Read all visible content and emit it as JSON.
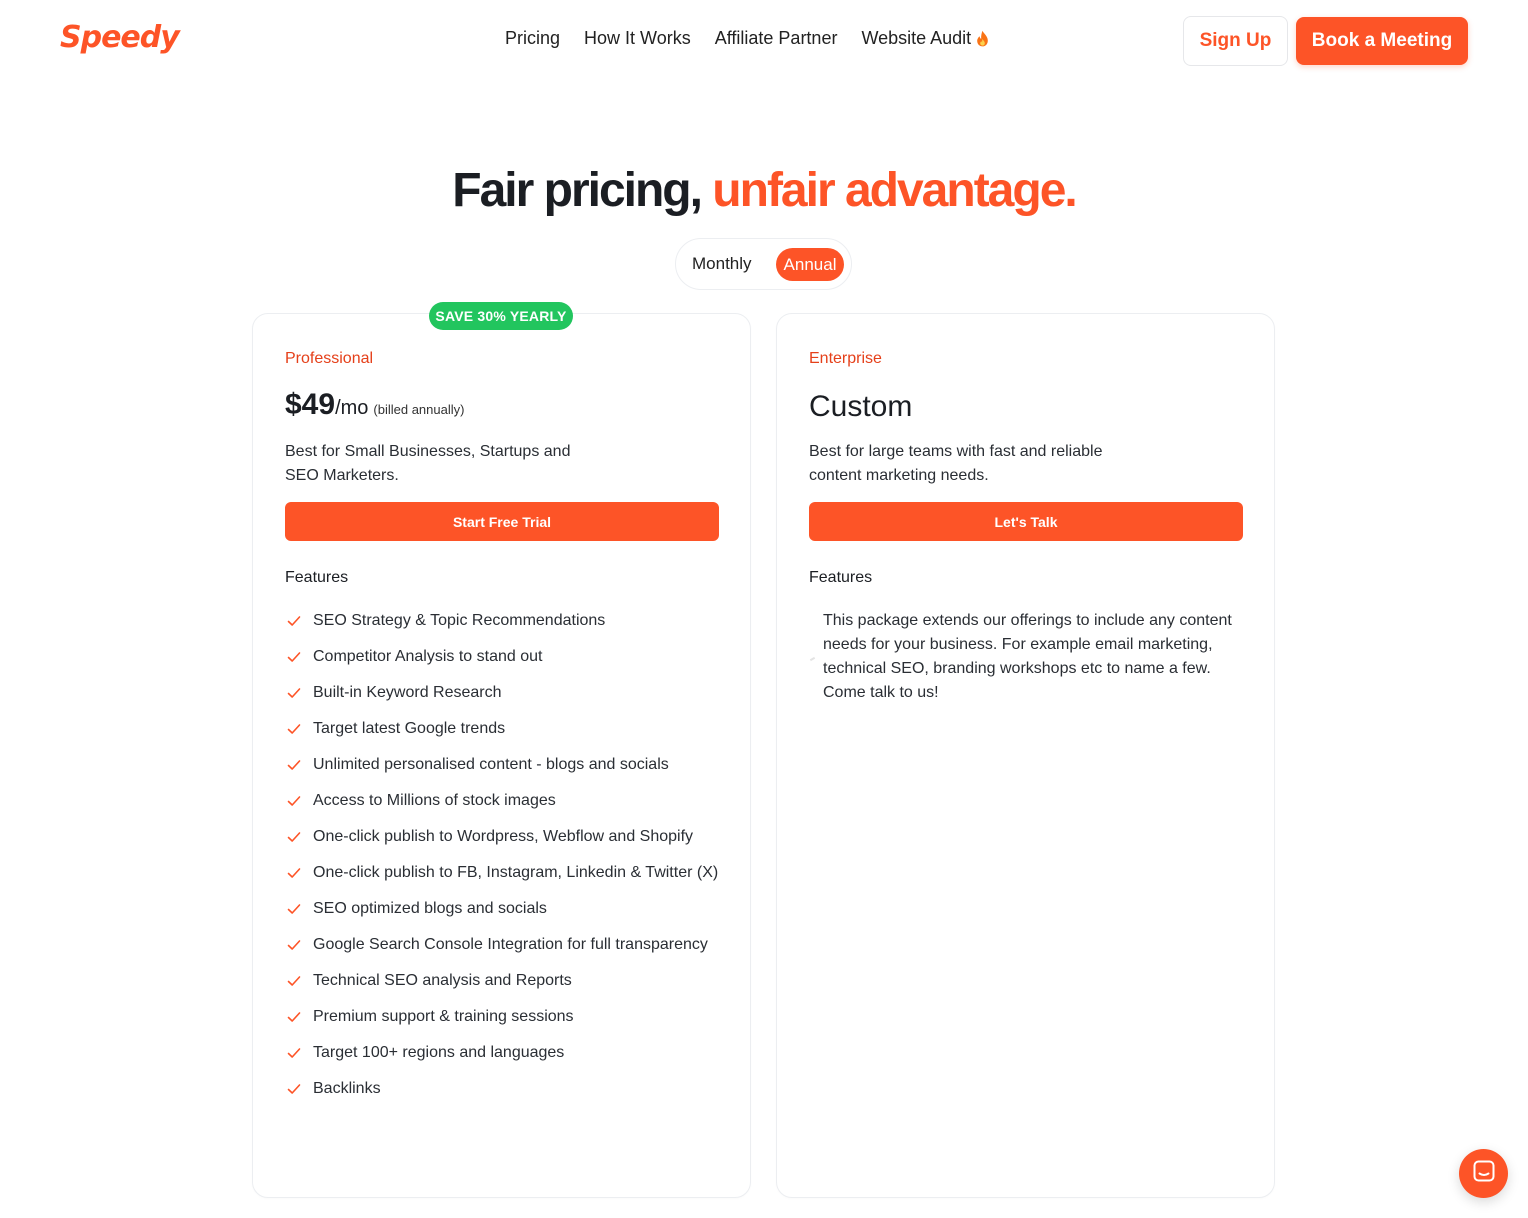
{
  "header": {
    "logo": "Speedy",
    "nav": [
      {
        "label": "Pricing"
      },
      {
        "label": "How It Works"
      },
      {
        "label": "Affiliate Partner"
      },
      {
        "label": "Website Audit",
        "icon": "flame-icon"
      }
    ],
    "signup_label": "Sign Up",
    "meeting_label": "Book a Meeting"
  },
  "hero": {
    "title_main": "Fair pricing, ",
    "title_accent": "unfair advantage."
  },
  "billing_toggle": {
    "monthly_label": "Monthly",
    "annual_label": "Annual",
    "selected": "Annual"
  },
  "plans": {
    "professional": {
      "badge": "SAVE 30% YEARLY",
      "name": "Professional",
      "price": "$49",
      "price_unit": "/mo",
      "price_note": "(billed annually)",
      "description": "Best for Small Businesses, Startups and SEO Marketers.",
      "cta": "Start Free Trial",
      "features_heading": "Features",
      "features": [
        "SEO Strategy & Topic Recommendations",
        "Competitor Analysis to stand out",
        "Built-in Keyword Research",
        "Target latest Google trends",
        "Unlimited personalised content - blogs and socials",
        "Access to Millions of stock images",
        "One-click publish to Wordpress, Webflow and Shopify",
        "One-click publish to FB, Instagram, Linkedin & Twitter (X)",
        "SEO optimized blogs and socials",
        "Google Search Console Integration for full transparency",
        "Technical SEO analysis and Reports",
        "Premium support & training sessions",
        "Target 100+ regions and languages",
        "Backlinks"
      ]
    },
    "enterprise": {
      "name": "Enterprise",
      "price": "Custom",
      "description": "Best for large teams with fast and reliable content marketing needs.",
      "cta": "Let's Talk",
      "features_heading": "Features",
      "features_text": "This package extends our offerings to include any content needs for your business. For example email marketing, technical SEO, branding workshops etc to name a few. Come talk to us!"
    }
  },
  "chat": {
    "icon": "chat-icon"
  },
  "colors": {
    "accent": "#fd5427",
    "badge_green": "#22c55e",
    "plan_name": "#e5401a"
  }
}
